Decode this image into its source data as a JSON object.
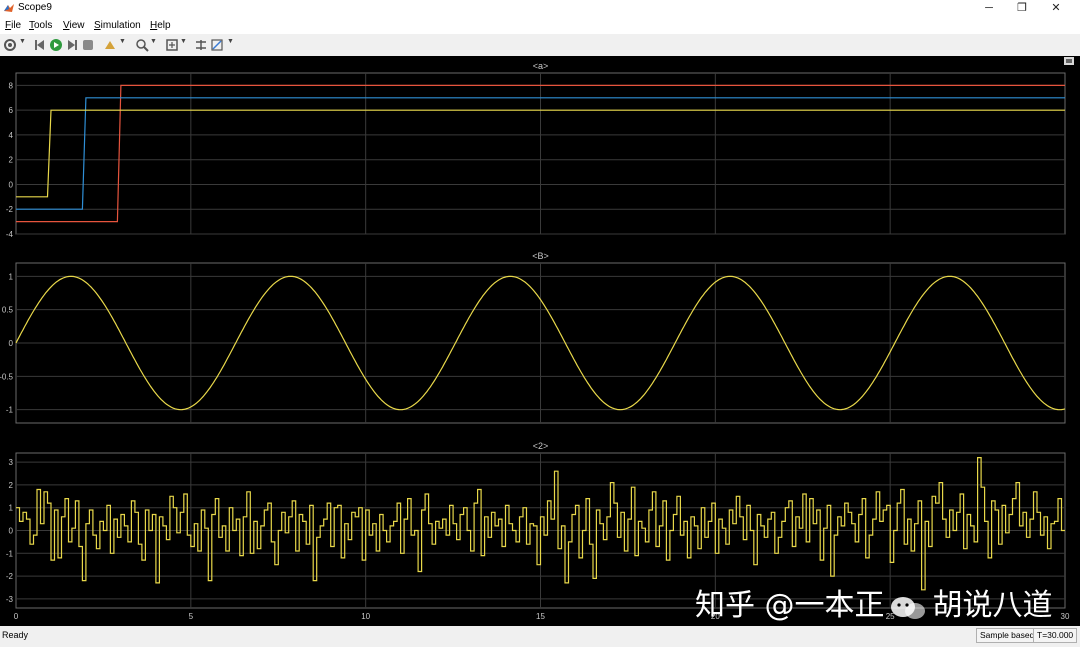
{
  "window": {
    "title": "Scope9",
    "minimize_glyph": "─",
    "maximize_glyph": "❐",
    "close_glyph": "✕"
  },
  "menu": [
    {
      "label": "File",
      "mnemonic": "F",
      "rest": "ile"
    },
    {
      "label": "Tools",
      "mnemonic": "T",
      "rest": "ools"
    },
    {
      "label": "View",
      "mnemonic": "V",
      "rest": "iew"
    },
    {
      "label": "Simulation",
      "mnemonic": "S",
      "rest": "imulation"
    },
    {
      "label": "Help",
      "mnemonic": "H",
      "rest": "elp"
    }
  ],
  "toolbar": {
    "icons": [
      "gear-icon",
      "step-back-icon",
      "run-icon",
      "step-forward-icon",
      "stop-icon",
      "highlight-icon",
      "zoom-icon",
      "fit-to-view-icon",
      "cursor-measure-icon",
      "style-icon"
    ]
  },
  "status": {
    "ready": "Ready",
    "mode": "Sample based",
    "time": "T=30.000"
  },
  "watermark": {
    "part1": "知乎 @一本正",
    "part2": "胡说八道"
  },
  "colors": {
    "background": "#000000",
    "axes_bg": "#000000",
    "grid": "#3a3a3a",
    "axis_text": "#c8c8c8",
    "red": "#e6543d",
    "blue": "#2f8fd6",
    "yellow": "#e8d84a"
  },
  "chart_data": [
    {
      "type": "line",
      "title": "<a>",
      "xlim": [
        0,
        30
      ],
      "ylim": [
        -4,
        9
      ],
      "yticks": [
        -4,
        -2,
        0,
        2,
        4,
        6,
        8
      ],
      "xticks": [
        0,
        5,
        10,
        15,
        20,
        25,
        30
      ],
      "grid": true,
      "step": true,
      "series": [
        {
          "color": "#e6543d",
          "x": [
            0,
            2.9,
            3.0,
            30
          ],
          "y": [
            -3,
            -3,
            8,
            8
          ]
        },
        {
          "color": "#2f8fd6",
          "x": [
            0,
            1.9,
            2.0,
            30
          ],
          "y": [
            -2,
            -2,
            7,
            7
          ]
        },
        {
          "color": "#e8d84a",
          "x": [
            0,
            0.9,
            1.0,
            30
          ],
          "y": [
            -1,
            -1,
            6,
            6
          ]
        }
      ]
    },
    {
      "type": "line",
      "title": "<B>",
      "xlim": [
        0,
        30
      ],
      "ylim": [
        -1.2,
        1.2
      ],
      "yticks": [
        -1,
        -0.5,
        0,
        0.5,
        1
      ],
      "ytick_labels": [
        "-1",
        "-0.5",
        "0",
        "0.5",
        "1"
      ],
      "xticks": [
        0,
        5,
        10,
        15,
        20,
        25,
        30
      ],
      "grid": true,
      "function": "sin(t)",
      "series": [
        {
          "color": "#e8d84a",
          "function": "sin",
          "amplitude": 1,
          "frequency_rad_per_s": 1
        }
      ]
    },
    {
      "type": "line",
      "title": "<2>",
      "xlim": [
        0,
        30
      ],
      "ylim": [
        -3.4,
        3.4
      ],
      "yticks": [
        -3,
        -2,
        -1,
        0,
        1,
        2,
        3
      ],
      "xticks": [
        0,
        5,
        10,
        15,
        20,
        25,
        30
      ],
      "xtick_labels": [
        "0",
        "5",
        "10",
        "15",
        "20",
        "25",
        "30"
      ],
      "grid": true,
      "step": true,
      "sample_time": 0.1,
      "series": [
        {
          "color": "#e8d84a",
          "values": [
            1.0,
            0.4,
            0.8,
            0.5,
            -0.6,
            -0.2,
            1.8,
            0.3,
            1.7,
            1.2,
            -1.3,
            0.9,
            -1.2,
            0.6,
            1.4,
            -0.5,
            0.1,
            1.3,
            -0.7,
            -2.2,
            0.3,
            0.9,
            -0.2,
            -0.8,
            0.4,
            0.0,
            1.1,
            -1.0,
            0.5,
            -0.3,
            0.7,
            0.2,
            -0.5,
            1.3,
            0.8,
            -0.6,
            -1.3,
            0.9,
            0.0,
            0.7,
            -2.3,
            0.6,
            0.2,
            -0.4,
            1.5,
            1.0,
            -0.1,
            0.8,
            1.6,
            -0.2,
            -0.7,
            0.3,
            -0.9,
            0.9,
            0.1,
            -2.2,
            0.7,
            1.4,
            -0.3,
            0.2,
            -0.9,
            1.0,
            0.0,
            0.5,
            -1.1,
            0.6,
            1.7,
            -1.0,
            0.4,
            -0.8,
            0.2,
            0.9,
            1.2,
            -0.5,
            -1.5,
            0.0,
            0.8,
            -0.1,
            0.6,
            1.3,
            -0.9,
            0.7,
            0.4,
            -0.6,
            1.1,
            -2.2,
            -0.3,
            0.2,
            0.5,
            1.2,
            -0.7,
            1.0,
            1.1,
            -1.2,
            0.3,
            -0.4,
            0.8,
            0.6,
            1.0,
            -1.3,
            0.9,
            -0.2,
            0.3,
            -0.9,
            0.7,
            0.0,
            -0.5,
            0.2,
            0.4,
            1.2,
            -1.0,
            0.5,
            1.4,
            -0.2,
            0.0,
            -1.8,
            0.9,
            1.6,
            0.3,
            -0.6,
            0.4,
            0.1,
            0.5,
            -0.2,
            1.1,
            0.3,
            -0.4,
            0.7,
            1.0,
            0.0,
            -0.9,
            1.2,
            1.8,
            -1.1,
            0.6,
            -0.3,
            0.8,
            0.2,
            0.5,
            -0.7,
            1.1,
            0.3,
            0.0,
            -0.5,
            0.6,
            1.0,
            -0.6,
            0.3,
            0.2,
            -1.5,
            0.6,
            -0.2,
            1.3,
            0.5,
            2.6,
            -0.8,
            0.2,
            -2.3,
            -0.5,
            0.7,
            1.1,
            -1.2,
            0.0,
            1.4,
            -0.6,
            -2.1,
            0.9,
            0.3,
            -0.4,
            0.6,
            2.1,
            1.2,
            -0.3,
            0.8,
            -0.9,
            0.5,
            1.9,
            -1.1,
            0.4,
            0.1,
            -0.5,
            0.9,
            1.7,
            -0.7,
            0.2,
            1.3,
            -1.3,
            0.0,
            0.7,
            1.5,
            -0.2,
            0.4,
            -1.2,
            0.6,
            0.2,
            -0.8,
            1.0,
            -0.3,
            0.4,
            1.2,
            -1.0,
            0.5,
            0.1,
            -0.6,
            0.9,
            0.3,
            1.5,
            0.6,
            -0.4,
            1.1,
            0.0,
            -1.5,
            0.7,
            0.2,
            -0.3,
            0.5,
            0.8,
            -1.0,
            -0.3,
            0.4,
            1.0,
            1.3,
            -0.7,
            0.6,
            0.1,
            1.6,
            -0.5,
            1.4,
            0.3,
            0.9,
            -1.3,
            0.1,
            1.1,
            -2.0,
            -0.2,
            0.6,
            0.2,
            1.2,
            0.8,
            0.3,
            -0.5,
            0.7,
            1.4,
            -1.2,
            -0.2,
            0.5,
            1.7,
            0.4,
            0.9,
            1.1,
            -1.4,
            0.0,
            1.2,
            1.8,
            -0.6,
            0.5,
            -0.9,
            0.3,
            1.3,
            -2.6,
            0.4,
            -0.7,
            1.5,
            1.2,
            2.1,
            0.5,
            -0.3,
            0.9,
            0.0,
            0.8,
            1.6,
            -0.8,
            0.7,
            0.2,
            -0.5,
            3.2,
            1.9,
            0.4,
            -1.2,
            1.3,
            0.9,
            -0.6,
            1.1,
            -0.1,
            0.7,
            1.4,
            2.1,
            0.2,
            0.8,
            -0.3,
            0.5,
            1.7,
            0.8,
            -0.2,
            0.6,
            -0.8,
            0.3,
            0.4,
            1.4,
            0.0
          ]
        }
      ]
    }
  ]
}
